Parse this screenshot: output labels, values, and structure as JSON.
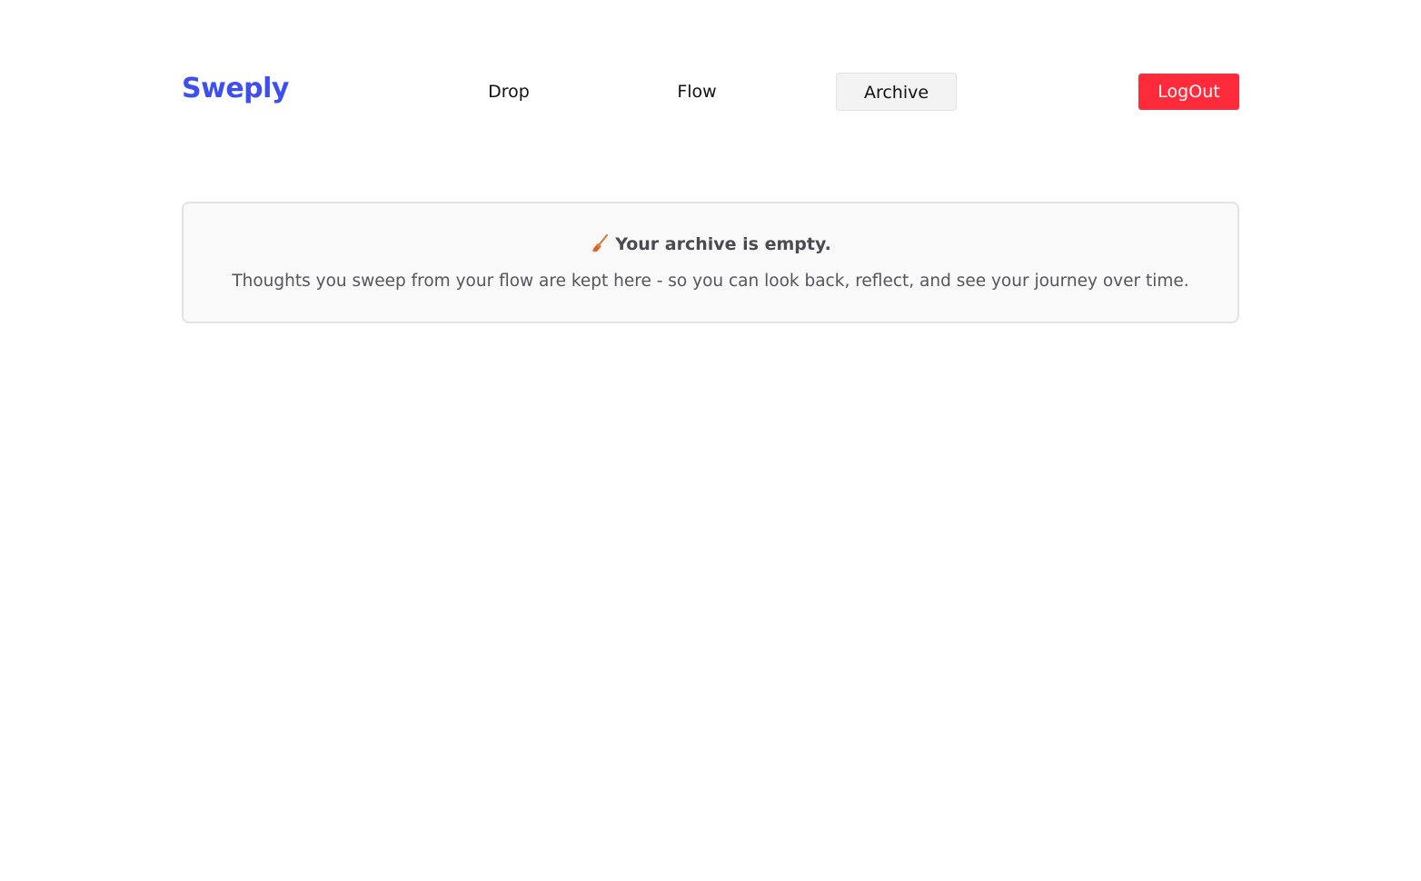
{
  "header": {
    "logo": "Sweply",
    "nav": [
      {
        "label": "Drop"
      },
      {
        "label": "Flow"
      },
      {
        "label": "Archive"
      }
    ],
    "logout_label": "LogOut"
  },
  "empty_state": {
    "icon": "broom-icon",
    "title": "Your archive is empty.",
    "description": "Thoughts you sweep from your flow are kept here - so you can look back, reflect, and see your journey over time."
  },
  "colors": {
    "brand": "#3d4ff0",
    "logout": "#ff2a3a",
    "active_nav_bg": "#f3f3f3",
    "card_bg": "#f9f9f9"
  }
}
